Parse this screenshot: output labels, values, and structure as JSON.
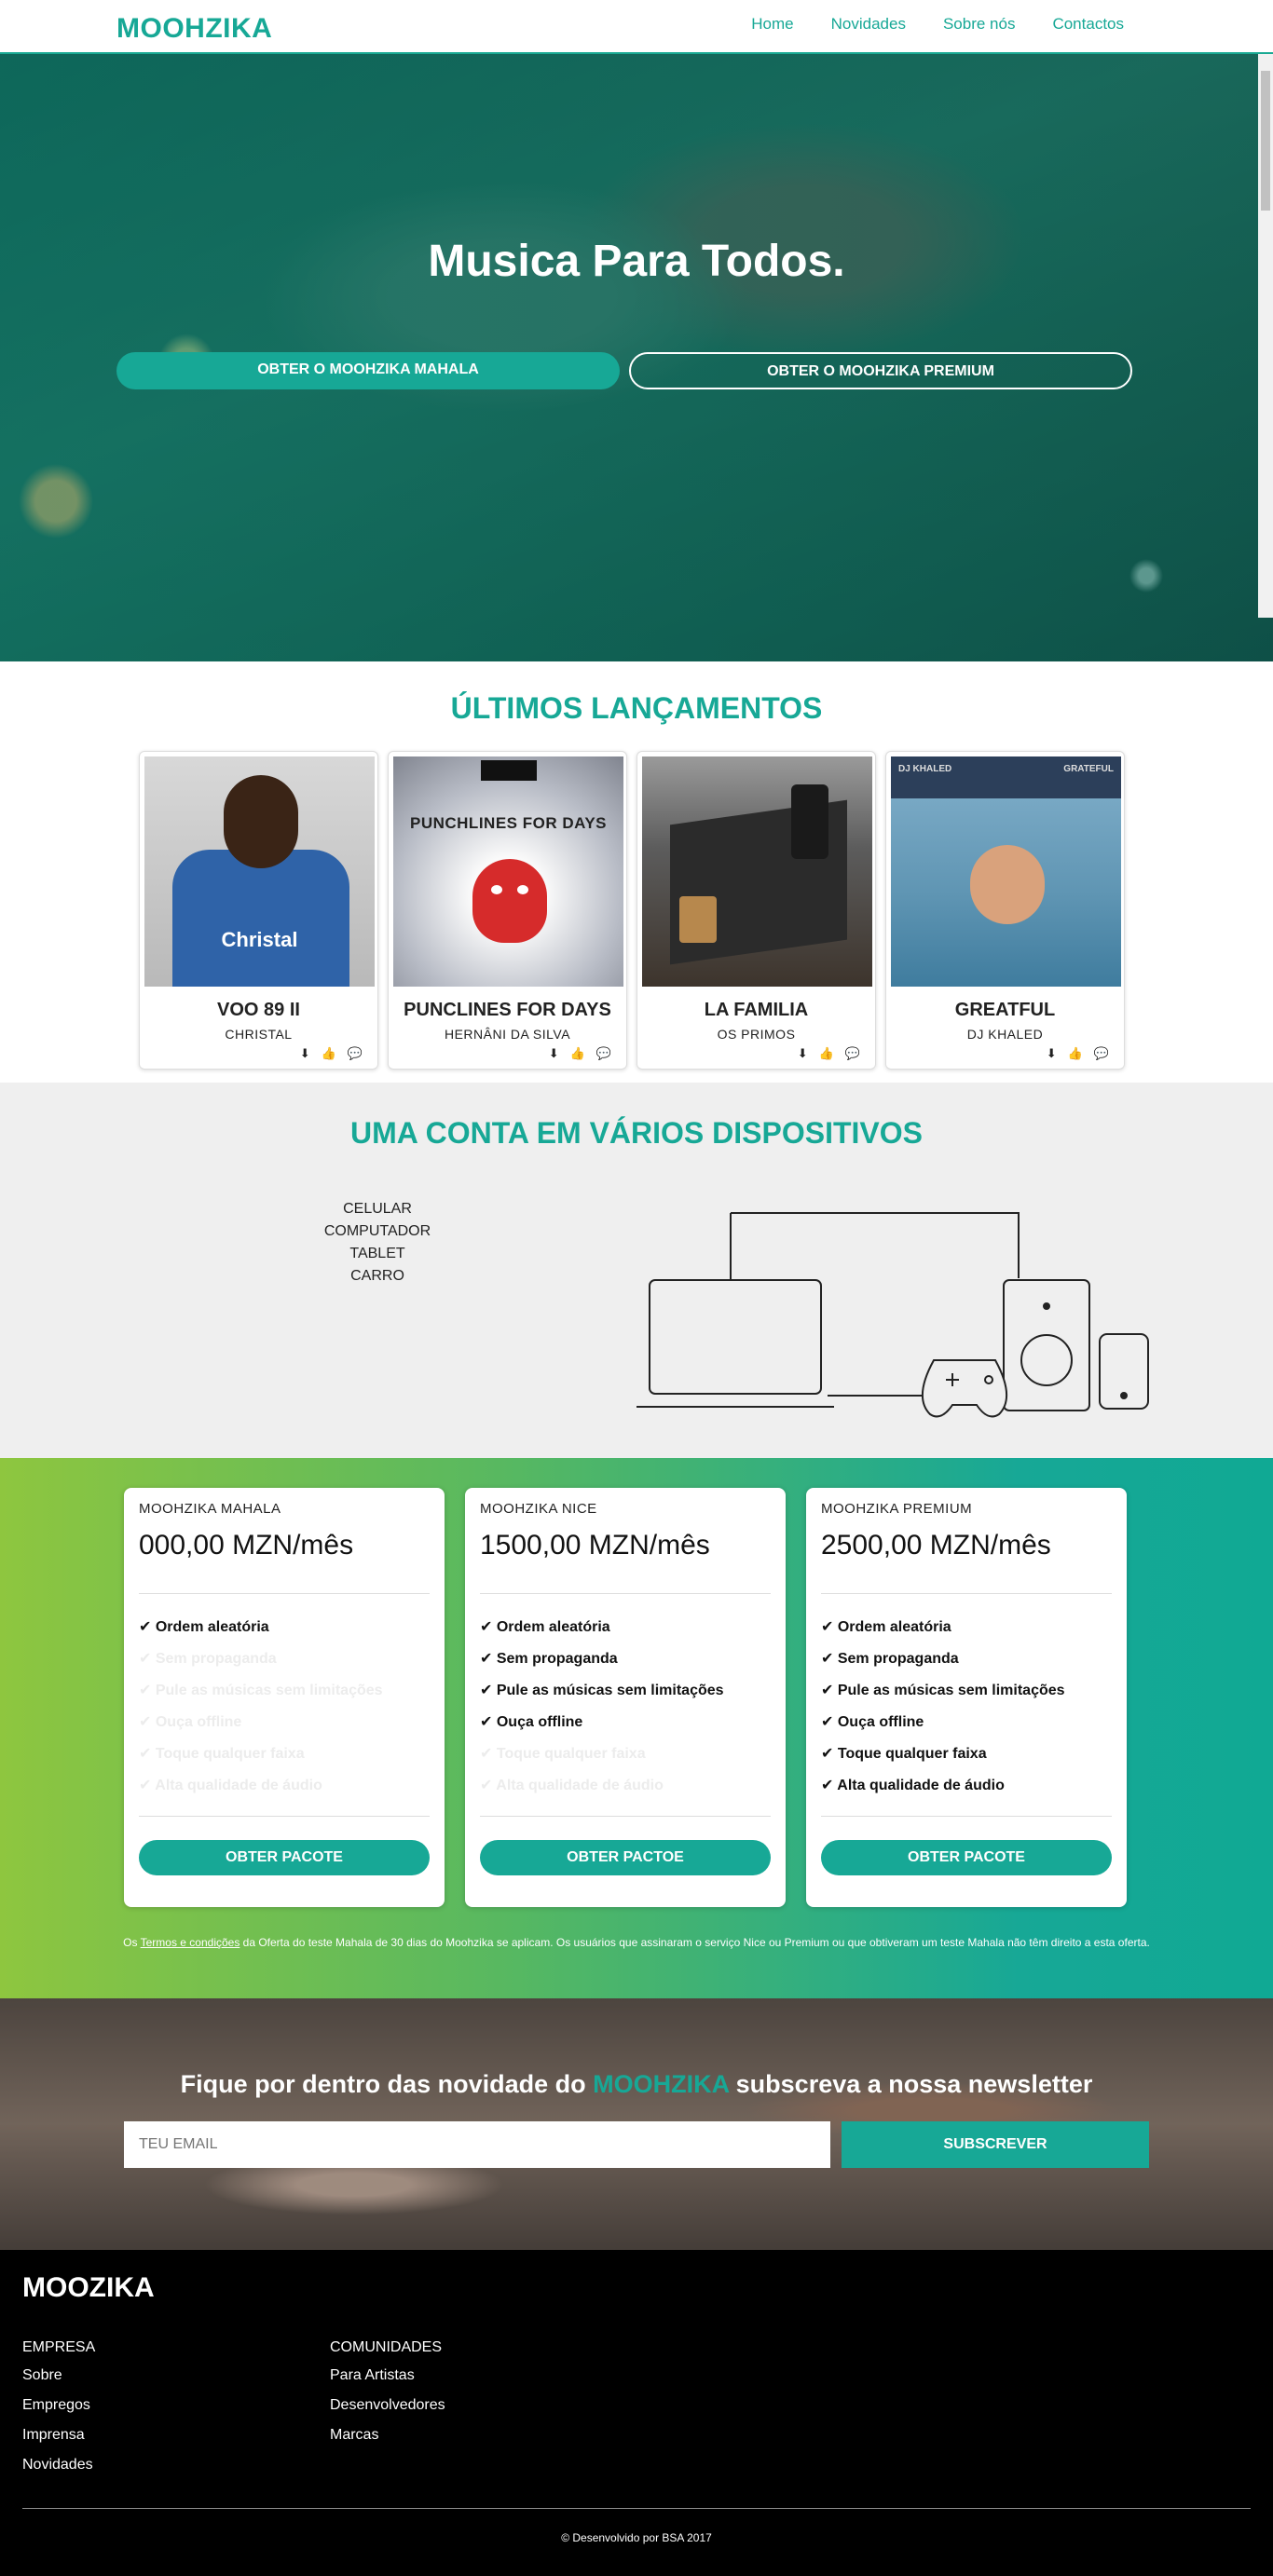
{
  "nav": {
    "brand": "MOOHZIKA",
    "links": [
      "Home",
      "Novidades",
      "Sobre nós",
      "Contactos"
    ]
  },
  "hero": {
    "title": "Musica Para Todos.",
    "btn_mahala": "OBTER O MOOHZIKA MAHALA",
    "btn_premium": "OBTER O MOOHZIKA PREMIUM"
  },
  "releases": {
    "title": "ÚLTIMOS LANÇAMENTOS",
    "items": [
      {
        "title": "VOO 89 II",
        "artist": "CHRISTAL",
        "cover_text": "Christal"
      },
      {
        "title": "PUNCLINES FOR DAYS",
        "artist": "HERNÂNI DA SILVA",
        "cover_text": "PUNCHLINES FOR DAYS"
      },
      {
        "title": "LA FAMILIA",
        "artist": "OS PRIMOS",
        "cover_text": ""
      },
      {
        "title": "GREATFUL",
        "artist": "DJ KHALED",
        "cover_text": "DJ KHALED",
        "cover_text2": "GRATEFUL"
      }
    ],
    "icons": [
      "download-icon",
      "thumbs-up-icon",
      "comment-icon"
    ]
  },
  "devices": {
    "title_accent": "UMA CONTA",
    "title_rest": " EM VÁRIOS DISPOSITIVOS",
    "list": [
      "CELULAR",
      "COMPUTADOR",
      "TABLET",
      "CARRO"
    ]
  },
  "pricing": {
    "plans": [
      {
        "name": "MOOHZIKA MAHALA",
        "price": "000,00 MZN/mês",
        "button": "OBTER PACOTE",
        "features": [
          {
            "label": "Ordem aleatória",
            "included": true
          },
          {
            "label": "Sem propaganda",
            "included": false
          },
          {
            "label": "Pule as músicas sem limitações",
            "included": false
          },
          {
            "label": "Ouça offline",
            "included": false
          },
          {
            "label": "Toque qualquer faixa",
            "included": false
          },
          {
            "label": "Alta qualidade de áudio",
            "included": false
          }
        ]
      },
      {
        "name": "MOOHZIKA NICE",
        "price": "1500,00 MZN/mês",
        "button": "OBTER PACTOE",
        "features": [
          {
            "label": "Ordem aleatória",
            "included": true
          },
          {
            "label": "Sem propaganda",
            "included": true
          },
          {
            "label": "Pule as músicas sem limitações",
            "included": true
          },
          {
            "label": "Ouça offline",
            "included": true
          },
          {
            "label": "Toque qualquer faixa",
            "included": false
          },
          {
            "label": "Alta qualidade de áudio",
            "included": false
          }
        ]
      },
      {
        "name": "MOOHZIKA PREMIUM",
        "price": "2500,00 MZN/mês",
        "button": "OBTER PACOTE",
        "features": [
          {
            "label": "Ordem aleatória",
            "included": true
          },
          {
            "label": "Sem propaganda",
            "included": true
          },
          {
            "label": "Pule as músicas sem limitações",
            "included": true
          },
          {
            "label": "Ouça offline",
            "included": true
          },
          {
            "label": "Toque qualquer faixa",
            "included": true
          },
          {
            "label": "Alta qualidade de áudio",
            "included": true
          }
        ]
      }
    ],
    "terms_prefix": "Os ",
    "terms_link": "Termos e condições",
    "terms_suffix": " da Oferta do teste Mahala de 30 dias do Moohzika se aplicam. Os usuários que assinaram o serviço Nice ou Premium ou que obtiveram um teste Mahala não têm direito a esta oferta."
  },
  "newsletter": {
    "title_prefix": "Fique por dentro das novidade do ",
    "title_accent": "MOOHZIKA",
    "title_suffix": " subscreva a nossa newsletter",
    "placeholder": "TEU EMAIL",
    "button": "SUBSCREVER"
  },
  "footer": {
    "brand": "MOOZIKA",
    "col1_title": "EMPRESA",
    "col1_links": [
      "Sobre",
      "Empregos",
      "Imprensa",
      "Novidades"
    ],
    "col2_title": "COMUNIDADES",
    "col2_links": [
      "Para Artistas",
      "Desenvolvedores",
      "Marcas"
    ],
    "copyright": "© Desenvolvido por BSA 2017"
  },
  "colors": {
    "accent": "#17a896",
    "footer_bg": "#000000",
    "devices_bg": "#efefef"
  }
}
